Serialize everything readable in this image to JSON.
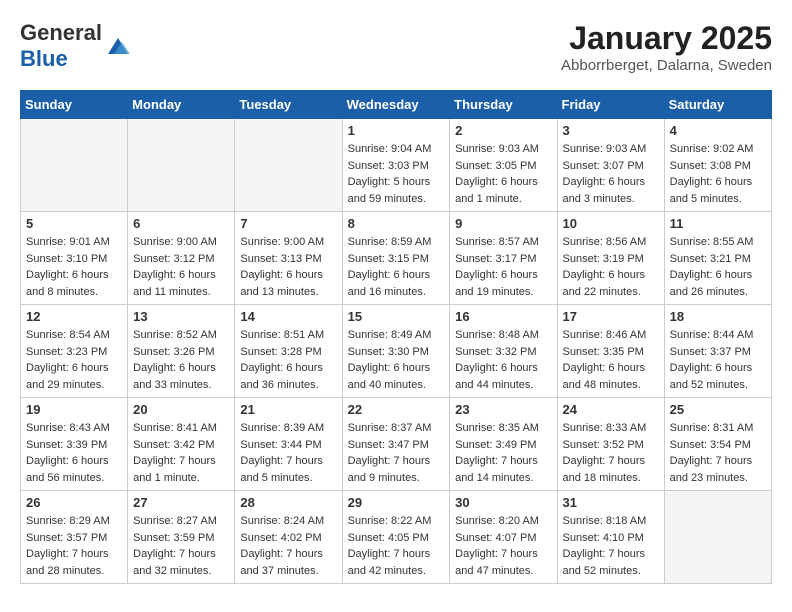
{
  "header": {
    "logo_general": "General",
    "logo_blue": "Blue",
    "month_year": "January 2025",
    "location": "Abborrberget, Dalarna, Sweden"
  },
  "days_of_week": [
    "Sunday",
    "Monday",
    "Tuesday",
    "Wednesday",
    "Thursday",
    "Friday",
    "Saturday"
  ],
  "weeks": [
    [
      {
        "num": "",
        "info": ""
      },
      {
        "num": "",
        "info": ""
      },
      {
        "num": "",
        "info": ""
      },
      {
        "num": "1",
        "info": "Sunrise: 9:04 AM\nSunset: 3:03 PM\nDaylight: 5 hours\nand 59 minutes."
      },
      {
        "num": "2",
        "info": "Sunrise: 9:03 AM\nSunset: 3:05 PM\nDaylight: 6 hours\nand 1 minute."
      },
      {
        "num": "3",
        "info": "Sunrise: 9:03 AM\nSunset: 3:07 PM\nDaylight: 6 hours\nand 3 minutes."
      },
      {
        "num": "4",
        "info": "Sunrise: 9:02 AM\nSunset: 3:08 PM\nDaylight: 6 hours\nand 5 minutes."
      }
    ],
    [
      {
        "num": "5",
        "info": "Sunrise: 9:01 AM\nSunset: 3:10 PM\nDaylight: 6 hours\nand 8 minutes."
      },
      {
        "num": "6",
        "info": "Sunrise: 9:00 AM\nSunset: 3:12 PM\nDaylight: 6 hours\nand 11 minutes."
      },
      {
        "num": "7",
        "info": "Sunrise: 9:00 AM\nSunset: 3:13 PM\nDaylight: 6 hours\nand 13 minutes."
      },
      {
        "num": "8",
        "info": "Sunrise: 8:59 AM\nSunset: 3:15 PM\nDaylight: 6 hours\nand 16 minutes."
      },
      {
        "num": "9",
        "info": "Sunrise: 8:57 AM\nSunset: 3:17 PM\nDaylight: 6 hours\nand 19 minutes."
      },
      {
        "num": "10",
        "info": "Sunrise: 8:56 AM\nSunset: 3:19 PM\nDaylight: 6 hours\nand 22 minutes."
      },
      {
        "num": "11",
        "info": "Sunrise: 8:55 AM\nSunset: 3:21 PM\nDaylight: 6 hours\nand 26 minutes."
      }
    ],
    [
      {
        "num": "12",
        "info": "Sunrise: 8:54 AM\nSunset: 3:23 PM\nDaylight: 6 hours\nand 29 minutes."
      },
      {
        "num": "13",
        "info": "Sunrise: 8:52 AM\nSunset: 3:26 PM\nDaylight: 6 hours\nand 33 minutes."
      },
      {
        "num": "14",
        "info": "Sunrise: 8:51 AM\nSunset: 3:28 PM\nDaylight: 6 hours\nand 36 minutes."
      },
      {
        "num": "15",
        "info": "Sunrise: 8:49 AM\nSunset: 3:30 PM\nDaylight: 6 hours\nand 40 minutes."
      },
      {
        "num": "16",
        "info": "Sunrise: 8:48 AM\nSunset: 3:32 PM\nDaylight: 6 hours\nand 44 minutes."
      },
      {
        "num": "17",
        "info": "Sunrise: 8:46 AM\nSunset: 3:35 PM\nDaylight: 6 hours\nand 48 minutes."
      },
      {
        "num": "18",
        "info": "Sunrise: 8:44 AM\nSunset: 3:37 PM\nDaylight: 6 hours\nand 52 minutes."
      }
    ],
    [
      {
        "num": "19",
        "info": "Sunrise: 8:43 AM\nSunset: 3:39 PM\nDaylight: 6 hours\nand 56 minutes."
      },
      {
        "num": "20",
        "info": "Sunrise: 8:41 AM\nSunset: 3:42 PM\nDaylight: 7 hours\nand 1 minute."
      },
      {
        "num": "21",
        "info": "Sunrise: 8:39 AM\nSunset: 3:44 PM\nDaylight: 7 hours\nand 5 minutes."
      },
      {
        "num": "22",
        "info": "Sunrise: 8:37 AM\nSunset: 3:47 PM\nDaylight: 7 hours\nand 9 minutes."
      },
      {
        "num": "23",
        "info": "Sunrise: 8:35 AM\nSunset: 3:49 PM\nDaylight: 7 hours\nand 14 minutes."
      },
      {
        "num": "24",
        "info": "Sunrise: 8:33 AM\nSunset: 3:52 PM\nDaylight: 7 hours\nand 18 minutes."
      },
      {
        "num": "25",
        "info": "Sunrise: 8:31 AM\nSunset: 3:54 PM\nDaylight: 7 hours\nand 23 minutes."
      }
    ],
    [
      {
        "num": "26",
        "info": "Sunrise: 8:29 AM\nSunset: 3:57 PM\nDaylight: 7 hours\nand 28 minutes."
      },
      {
        "num": "27",
        "info": "Sunrise: 8:27 AM\nSunset: 3:59 PM\nDaylight: 7 hours\nand 32 minutes."
      },
      {
        "num": "28",
        "info": "Sunrise: 8:24 AM\nSunset: 4:02 PM\nDaylight: 7 hours\nand 37 minutes."
      },
      {
        "num": "29",
        "info": "Sunrise: 8:22 AM\nSunset: 4:05 PM\nDaylight: 7 hours\nand 42 minutes."
      },
      {
        "num": "30",
        "info": "Sunrise: 8:20 AM\nSunset: 4:07 PM\nDaylight: 7 hours\nand 47 minutes."
      },
      {
        "num": "31",
        "info": "Sunrise: 8:18 AM\nSunset: 4:10 PM\nDaylight: 7 hours\nand 52 minutes."
      },
      {
        "num": "",
        "info": ""
      }
    ]
  ]
}
